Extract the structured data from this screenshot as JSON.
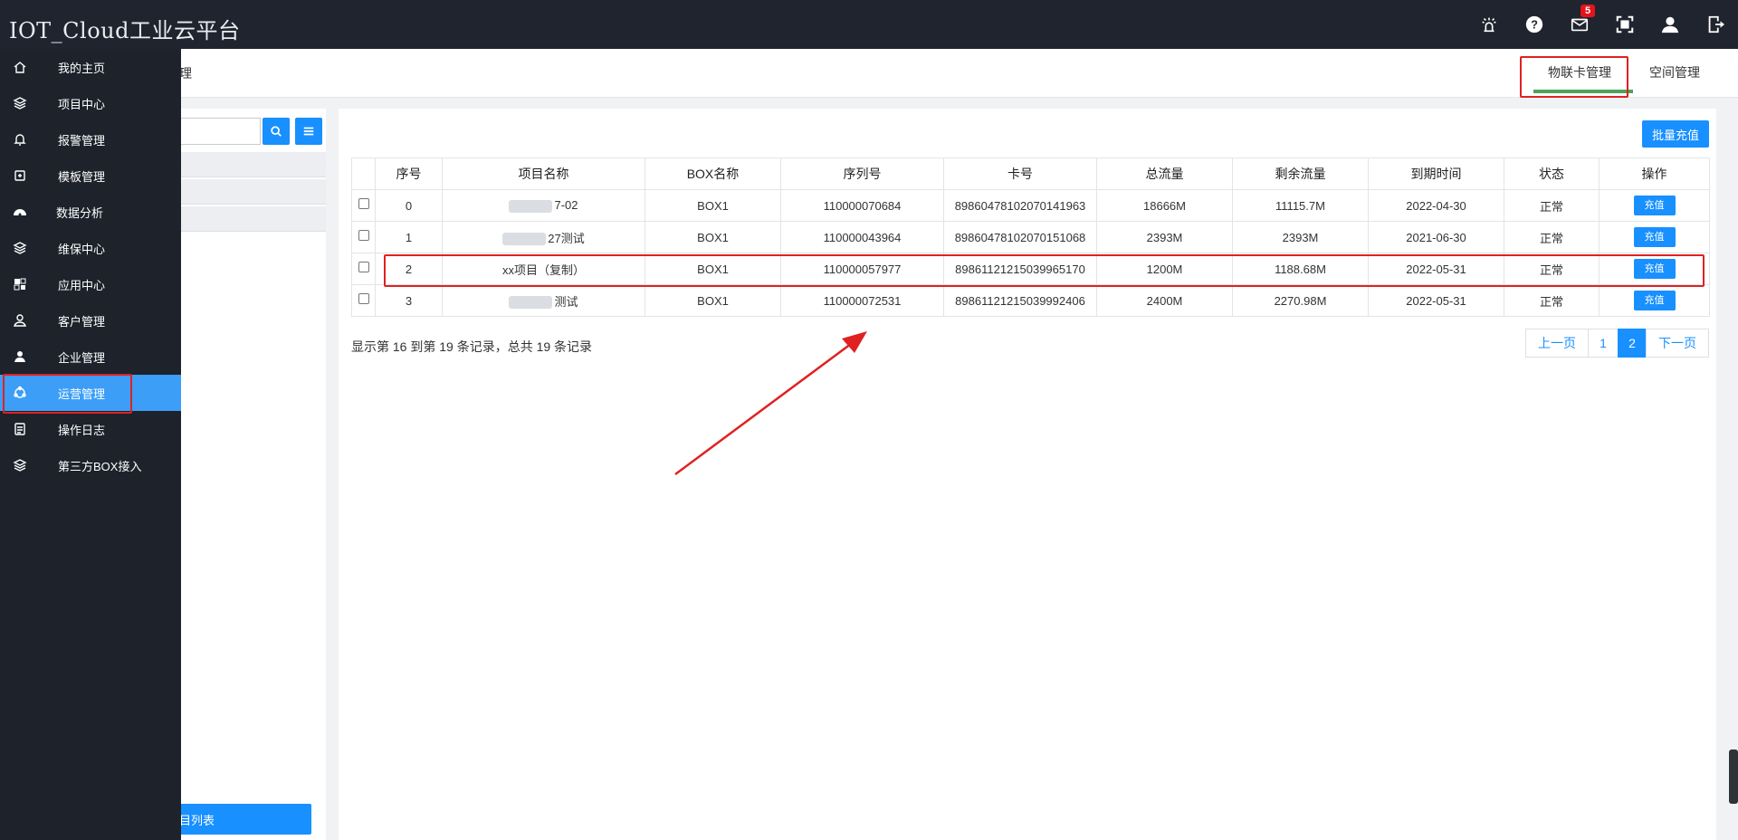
{
  "app": {
    "title": "IOT_Cloud工业云平台",
    "notification_count": "5"
  },
  "top_icons": [
    "alarm-light-icon",
    "help-icon",
    "mail-icon",
    "fullscreen-icon",
    "user-icon",
    "logout-icon"
  ],
  "sidebar": {
    "items": [
      {
        "label": "我的主页",
        "icon": "home-icon"
      },
      {
        "label": "项目中心",
        "icon": "layers-icon"
      },
      {
        "label": "报警管理",
        "icon": "bell-icon"
      },
      {
        "label": "模板管理",
        "icon": "template-icon"
      },
      {
        "label": "数据分析",
        "icon": "dashboard-icon"
      },
      {
        "label": "维保中心",
        "icon": "layers-icon"
      },
      {
        "label": "应用中心",
        "icon": "apps-icon"
      },
      {
        "label": "客户管理",
        "icon": "customer-icon"
      },
      {
        "label": "企业管理",
        "icon": "enterprise-icon"
      },
      {
        "label": "运营管理",
        "icon": "operations-icon"
      },
      {
        "label": "操作日志",
        "icon": "log-icon"
      },
      {
        "label": "第三方BOX接入",
        "icon": "layers-icon"
      }
    ],
    "active": "运营管理"
  },
  "header": {
    "partial_tab": "理",
    "tabs": {
      "sim": "物联卡管理",
      "space": "空间管理"
    }
  },
  "left_panel": {
    "project_list_button": "目列表"
  },
  "main": {
    "batch_button": "批量充值",
    "columns": [
      "序号",
      "项目名称",
      "BOX名称",
      "序列号",
      "卡号",
      "总流量",
      "剩余流量",
      "到期时间",
      "状态",
      "操作"
    ],
    "rows": [
      {
        "index": "0",
        "project": "7-02",
        "box": "BOX1",
        "serial": "110000070684",
        "card": "89860478102070141963",
        "total": "18666M",
        "remaining": "11115.7M",
        "expire": "2022-04-30",
        "status": "正常",
        "action": "充值"
      },
      {
        "index": "1",
        "project": "27测试",
        "box": "BOX1",
        "serial": "110000043964",
        "card": "89860478102070151068",
        "total": "2393M",
        "remaining": "2393M",
        "expire": "2021-06-30",
        "status": "正常",
        "action": "充值"
      },
      {
        "index": "2",
        "project": "xx项目（复制）",
        "box": "BOX1",
        "serial": "110000057977",
        "card": "89861121215039965170",
        "total": "1200M",
        "remaining": "1188.68M",
        "expire": "2022-05-31",
        "status": "正常",
        "action": "充值"
      },
      {
        "index": "3",
        "project": "测试",
        "box": "BOX1",
        "serial": "110000072531",
        "card": "89861121215039992406",
        "total": "2400M",
        "remaining": "2270.98M",
        "expire": "2022-05-31",
        "status": "正常",
        "action": "充值"
      }
    ],
    "summary": "显示第 16 到第 19 条记录，总共 19 条记录",
    "pager": {
      "prev": "上一页",
      "pages": [
        "1",
        "2"
      ],
      "current": "2",
      "next": "下一页"
    }
  },
  "colors": {
    "accent": "#1890ff",
    "sidebar_bg": "#1d222b",
    "topbar_bg": "#1f242e",
    "highlight_red": "#e02121",
    "tab_underline": "#4ca35c"
  }
}
